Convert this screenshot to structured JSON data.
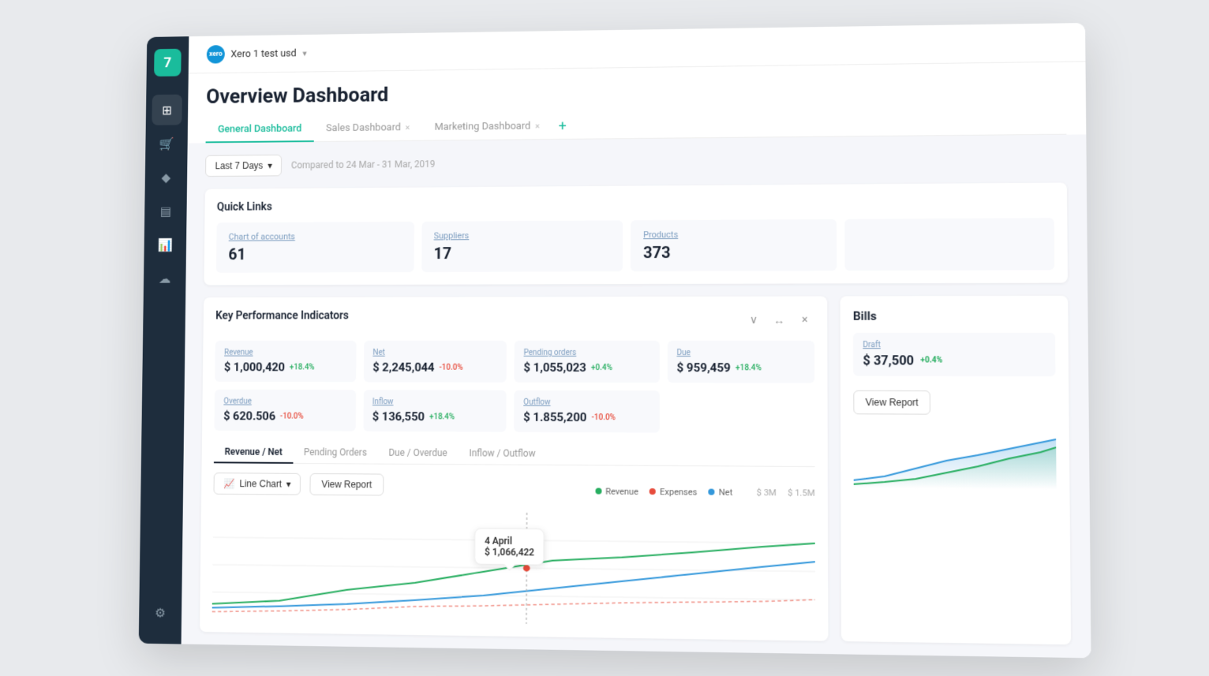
{
  "app": {
    "logo": "7",
    "logoColor": "#1abc9c"
  },
  "topbar": {
    "xero_label": "xero",
    "company_name": "Xero 1 test usd",
    "chevron": "▾"
  },
  "header": {
    "title": "Overview Dashboard",
    "tabs": [
      {
        "label": "General Dashboard",
        "active": true,
        "closeable": false
      },
      {
        "label": "Sales Dashboard",
        "active": false,
        "closeable": true
      },
      {
        "label": "Marketing Dashboard",
        "active": false,
        "closeable": true
      }
    ],
    "add_tab": "+"
  },
  "date_filter": {
    "label": "Last 7 Days",
    "chevron": "▾",
    "compare_text": "Compared to 24 Mar - 31 Mar, 2019"
  },
  "quick_links": {
    "title": "Quick Links",
    "items": [
      {
        "label": "Chart of accounts",
        "value": "61"
      },
      {
        "label": "Suppliers",
        "value": "17"
      },
      {
        "label": "Products",
        "value": "373"
      },
      {
        "label": "",
        "value": ""
      }
    ]
  },
  "kpi": {
    "title": "Key Performance Indicators",
    "controls": {
      "collapse": "∨",
      "expand": "↔",
      "close": "×"
    },
    "metrics": [
      {
        "label": "Revenue",
        "value": "$ 1,000,420",
        "badge": "+18.4%",
        "badge_type": "green"
      },
      {
        "label": "Net",
        "value": "$ 2,245,044",
        "badge": "-10.0%",
        "badge_type": "red"
      },
      {
        "label": "Pending orders",
        "value": "$ 1,055,023",
        "badge": "+0.4%",
        "badge_type": "green"
      },
      {
        "label": "Due",
        "value": "$ 959,459",
        "badge": "+18.4%",
        "badge_type": "green"
      },
      {
        "label": "Overdue",
        "value": "$ 620.506",
        "badge": "-10.0%",
        "badge_type": "red"
      },
      {
        "label": "Inflow",
        "value": "$ 136,550",
        "badge": "+18.4%",
        "badge_type": "green"
      },
      {
        "label": "Outflow",
        "value": "$ 1.855,200",
        "badge": "-10.0%",
        "badge_type": "red"
      }
    ],
    "tabs": [
      {
        "label": "Revenue / Net",
        "active": true
      },
      {
        "label": "Pending Orders",
        "active": false
      },
      {
        "label": "Due / Overdue",
        "active": false
      },
      {
        "label": "Inflow / Outflow",
        "active": false
      }
    ],
    "chart_type_label": "Line Chart",
    "view_report_label": "View Report",
    "legend": [
      {
        "label": "Revenue",
        "color": "#27ae60"
      },
      {
        "label": "Expenses",
        "color": "#e74c3c"
      },
      {
        "label": "Net",
        "color": "#3498db"
      }
    ],
    "chart_y_labels": [
      "$ 3M",
      "$ 1.5M"
    ],
    "tooltip": {
      "date": "4 April",
      "value": "$ 1,066,422"
    }
  },
  "bills": {
    "title": "Bills",
    "draft_label": "Draft",
    "draft_value": "$ 37,500",
    "draft_badge": "+0.4%",
    "view_report_label": "View Report"
  },
  "sidebar": {
    "items": [
      {
        "icon": "⊞",
        "active": true,
        "name": "dashboard"
      },
      {
        "icon": "🛒",
        "active": false,
        "name": "orders"
      },
      {
        "icon": "◆",
        "active": false,
        "name": "tags"
      },
      {
        "icon": "▤",
        "active": false,
        "name": "inventory"
      },
      {
        "icon": "⊡",
        "active": false,
        "name": "reports"
      },
      {
        "icon": "⚙",
        "active": false,
        "name": "settings"
      }
    ]
  }
}
